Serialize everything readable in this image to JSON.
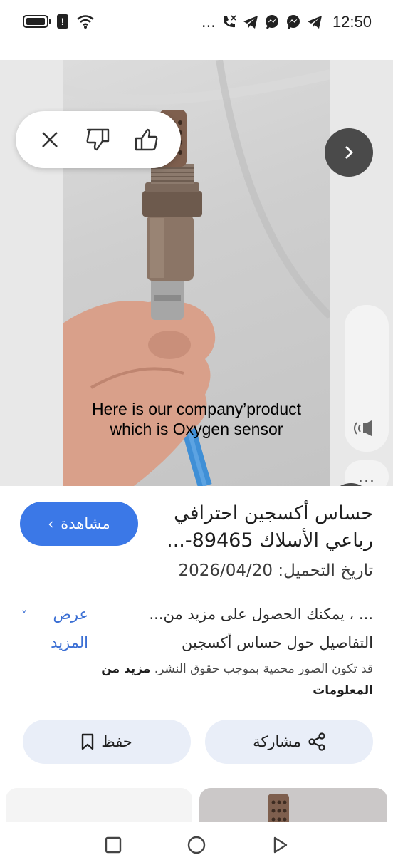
{
  "status_bar": {
    "time": "12:50",
    "left_icons": [
      "battery-icon",
      "warning-icon",
      "wifi-icon"
    ],
    "right_icons": [
      "more-dots-icon",
      "missed-call-icon",
      "telegram-icon",
      "messenger-icon",
      "messenger-icon",
      "telegram-icon"
    ],
    "overflow": "..."
  },
  "viewer": {
    "caption_line1": "Here is our company’product",
    "caption_line2": "which is Oxygen sensor",
    "more_label": "..."
  },
  "result": {
    "visit_label": "مشاهدة",
    "title": "حساس أكسجين احترافي رباعي الأسلاك 89465-...",
    "upload_date": "تاريخ التحميل: 2026/04/20",
    "description": "... ، يمكنك الحصول على مزيد من... التفاصيل حول حساس أكسجين",
    "show_more": "عرض المزيد",
    "copyright_text": "قد تكون الصور محمية بموجب حقوق النشر.",
    "copyright_more": "مزيد من المعلومات",
    "save_label": "حفظ",
    "share_label": "مشاركة"
  },
  "colors": {
    "accent": "#3b78e7",
    "link": "#3b6fd4",
    "button_bg": "#e9eef8",
    "cable": "#3f8fd6"
  }
}
